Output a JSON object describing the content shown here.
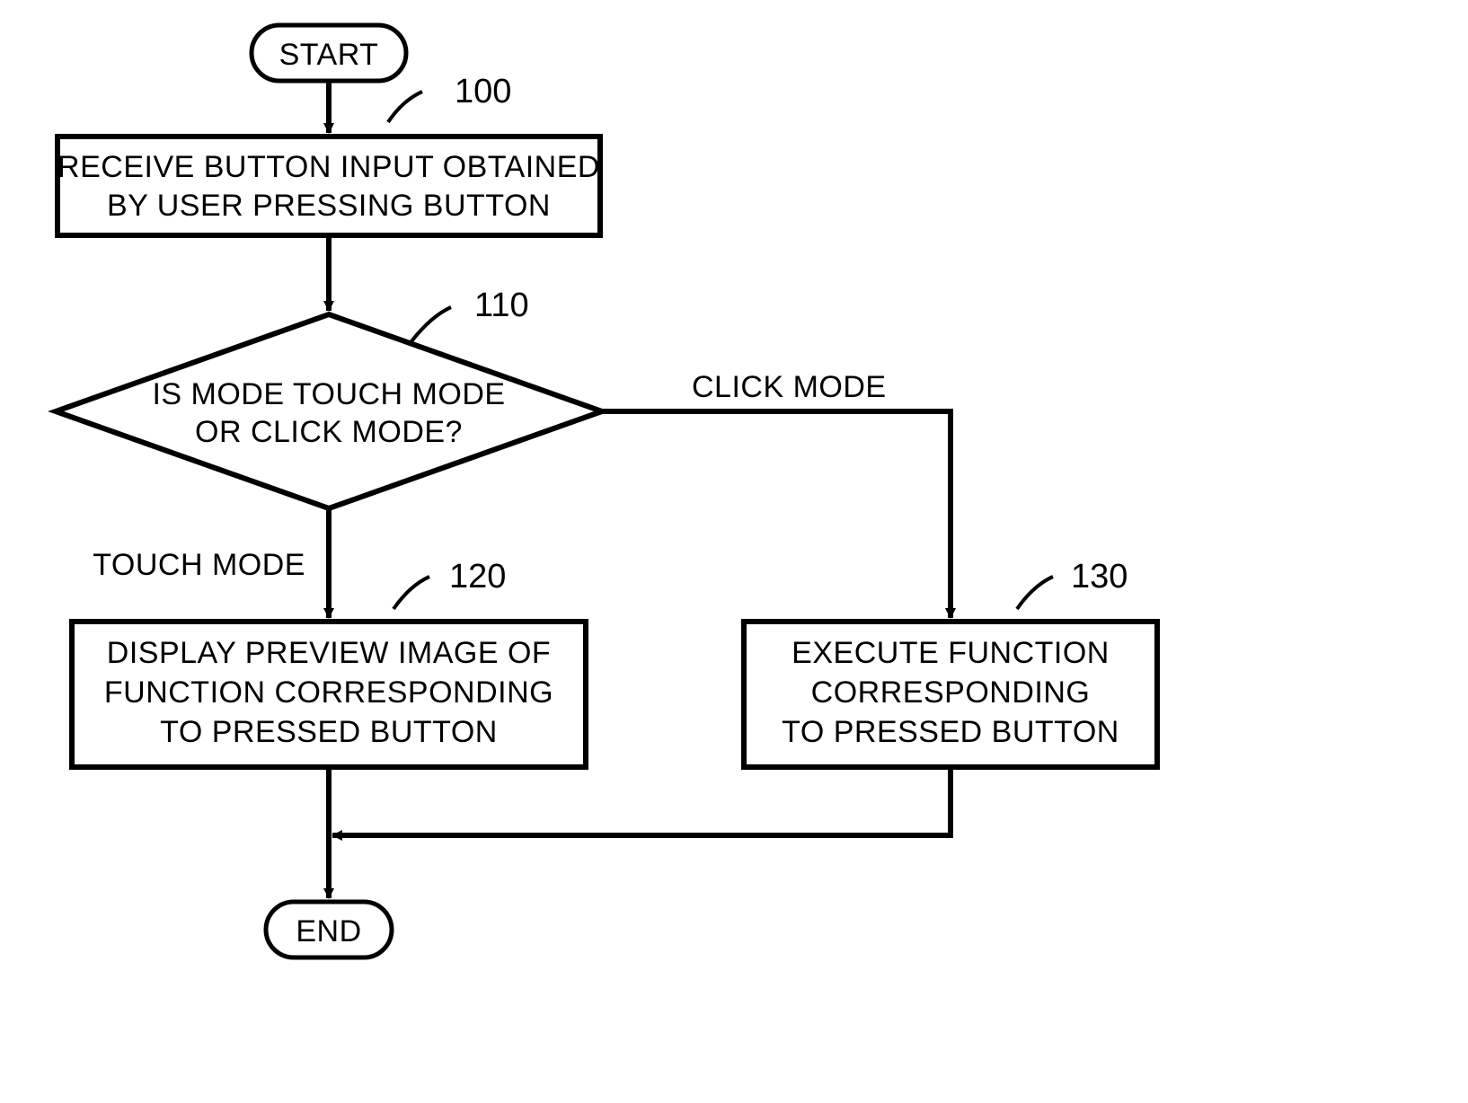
{
  "terminals": {
    "start": "START",
    "end": "END"
  },
  "nodes": {
    "n100": {
      "ref": "100",
      "line1": "RECEIVE BUTTON INPUT OBTAINED",
      "line2": "BY USER PRESSING BUTTON"
    },
    "n110": {
      "ref": "110",
      "line1": "IS MODE TOUCH MODE",
      "line2": "OR CLICK MODE?"
    },
    "n120": {
      "ref": "120",
      "line1": "DISPLAY PREVIEW IMAGE OF",
      "line2": "FUNCTION CORRESPONDING",
      "line3": "TO PRESSED BUTTON"
    },
    "n130": {
      "ref": "130",
      "line1": "EXECUTE FUNCTION",
      "line2": "CORRESPONDING",
      "line3": "TO PRESSED BUTTON"
    }
  },
  "branches": {
    "click": "CLICK MODE",
    "touch": "TOUCH MODE"
  }
}
